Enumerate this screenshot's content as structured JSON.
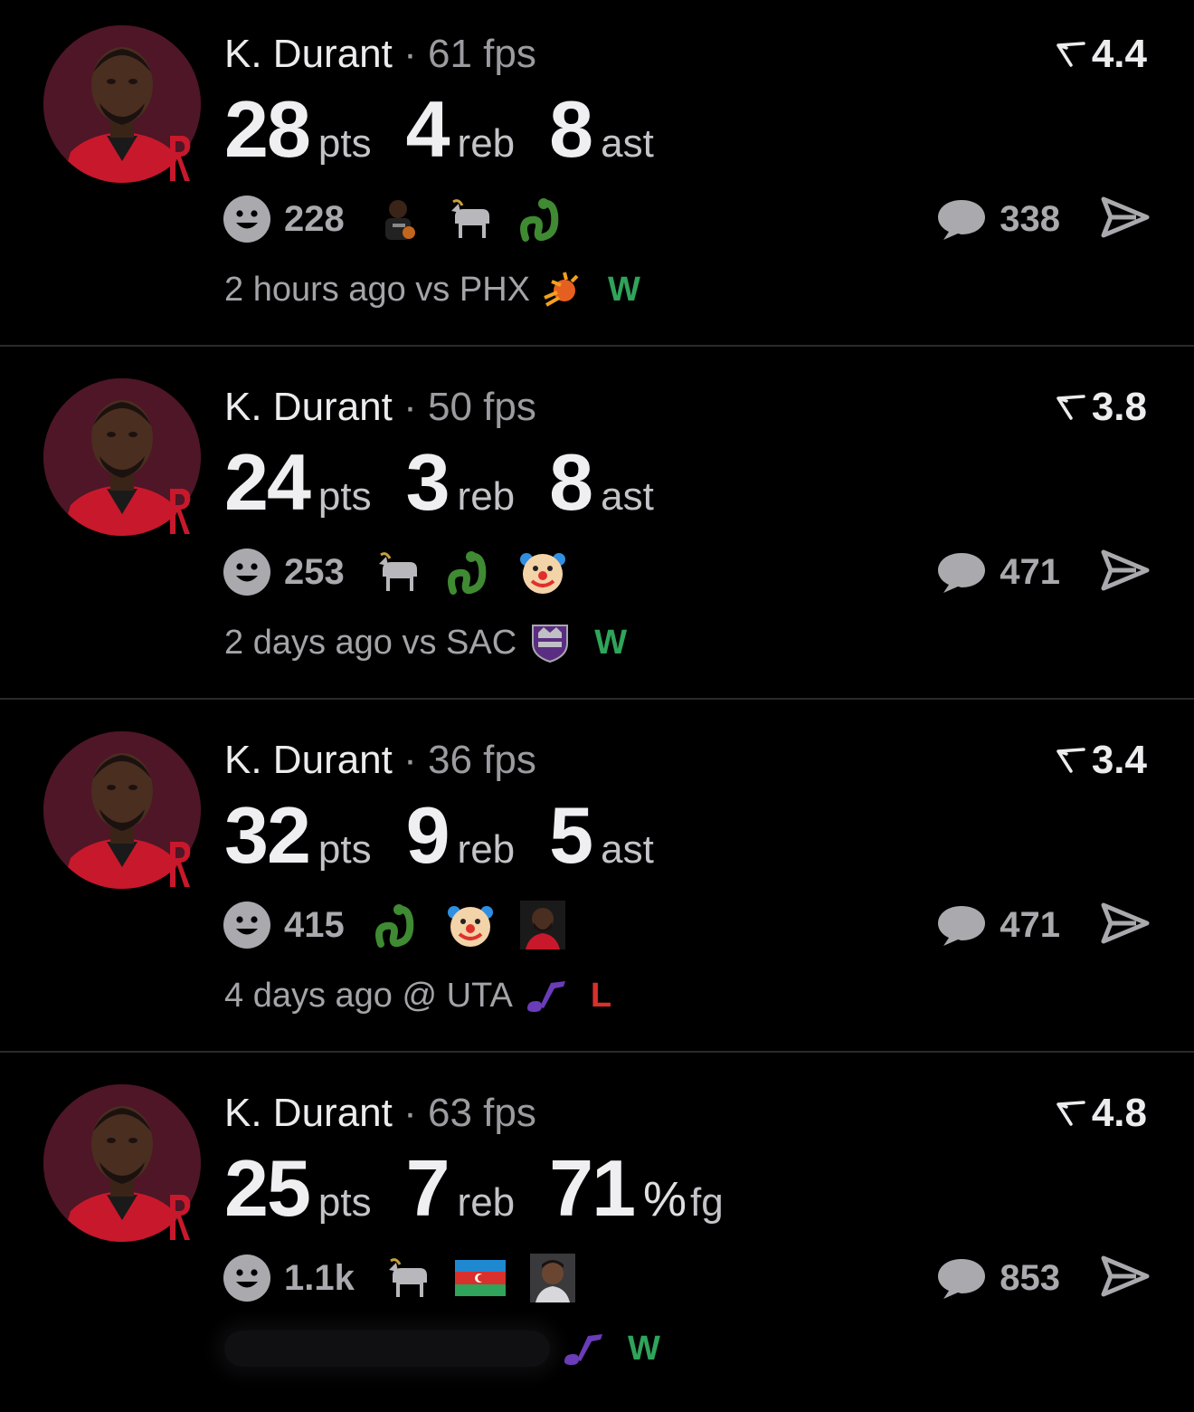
{
  "colors": {
    "background": "#000000",
    "win": "#2fa45a",
    "loss": "#d8302c",
    "muted_text": "#9b9ba0",
    "avatar_bg": "#4e1626"
  },
  "posts": [
    {
      "player": "K. Durant",
      "separator": "·",
      "fps": "61 fps",
      "rating": "4.4",
      "stats": [
        {
          "value": "28",
          "unit": "pts"
        },
        {
          "value": "4",
          "unit": "reb"
        },
        {
          "value": "8",
          "unit": "ast"
        }
      ],
      "reaction_count": "228",
      "reaction_emojis": [
        "player-photo-icon",
        "goat-icon",
        "snake-icon"
      ],
      "comment_count": "338",
      "time_ago": "2 hours ago",
      "venue": "vs",
      "opponent": "PHX",
      "opponent_logo": "suns-logo-icon",
      "result": "W"
    },
    {
      "player": "K. Durant",
      "separator": "·",
      "fps": "50 fps",
      "rating": "3.8",
      "stats": [
        {
          "value": "24",
          "unit": "pts"
        },
        {
          "value": "3",
          "unit": "reb"
        },
        {
          "value": "8",
          "unit": "ast"
        }
      ],
      "reaction_count": "253",
      "reaction_emojis": [
        "goat-icon",
        "snake-icon",
        "clown-icon"
      ],
      "comment_count": "471",
      "time_ago": "2 days ago",
      "venue": "vs",
      "opponent": "SAC",
      "opponent_logo": "kings-logo-icon",
      "result": "W"
    },
    {
      "player": "K. Durant",
      "separator": "·",
      "fps": "36 fps",
      "rating": "3.4",
      "stats": [
        {
          "value": "32",
          "unit": "pts"
        },
        {
          "value": "9",
          "unit": "reb"
        },
        {
          "value": "5",
          "unit": "ast"
        }
      ],
      "reaction_count": "415",
      "reaction_emojis": [
        "snake-icon",
        "clown-icon",
        "player-photo-icon"
      ],
      "comment_count": "471",
      "time_ago": "4 days ago",
      "venue": "@",
      "opponent": "UTA",
      "opponent_logo": "jazz-logo-icon",
      "result": "L"
    },
    {
      "player": "K. Durant",
      "separator": "·",
      "fps": "63 fps",
      "rating": "4.8",
      "stats": [
        {
          "value": "25",
          "unit": "pts"
        },
        {
          "value": "7",
          "unit": "reb"
        },
        {
          "value": "71",
          "unit": "fg",
          "prefix": "%"
        }
      ],
      "reaction_count": "1.1k",
      "reaction_emojis": [
        "goat-icon",
        "azerbaijan-flag-icon",
        "person-photo-icon"
      ],
      "comment_count": "853",
      "time_ago": "",
      "venue": "",
      "opponent": "",
      "opponent_logo": "jazz-logo-icon",
      "result": "W"
    }
  ]
}
